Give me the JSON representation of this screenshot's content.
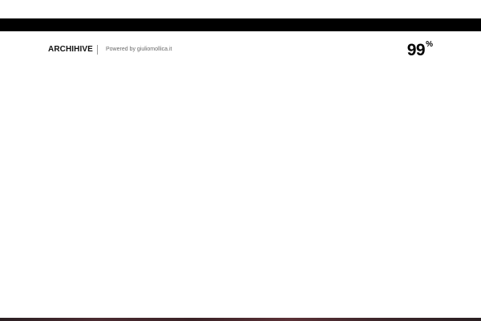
{
  "header": {
    "brand": "ARCHIHIVE",
    "powered_by": "Powered by giuliomollica.it"
  },
  "loader": {
    "value": "99",
    "unit": "%"
  },
  "colors": {
    "top_bar": "#000000",
    "background": "#ffffff",
    "text": "#111111",
    "muted_text": "#6a6a6a"
  }
}
